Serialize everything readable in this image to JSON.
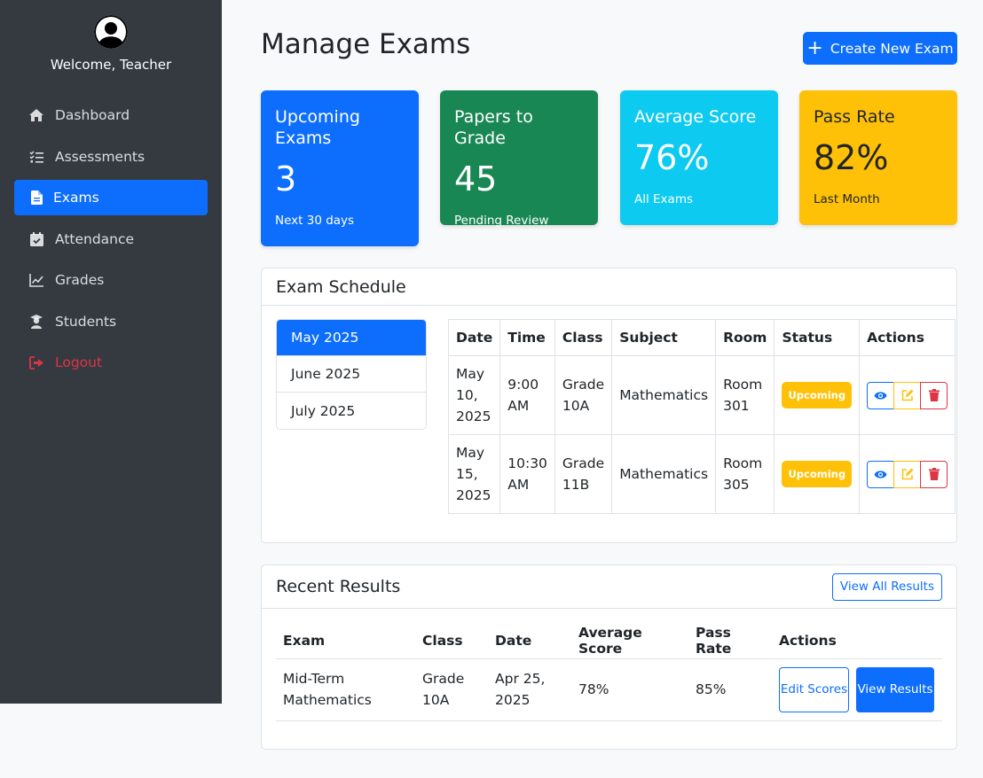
{
  "sidebar": {
    "welcome": "Welcome, Teacher",
    "items": [
      {
        "label": "Dashboard",
        "icon": "home-icon"
      },
      {
        "label": "Assessments",
        "icon": "tasks-icon"
      },
      {
        "label": "Exams",
        "icon": "file-icon",
        "active": true
      },
      {
        "label": "Attendance",
        "icon": "calendar-check-icon"
      },
      {
        "label": "Grades",
        "icon": "chart-line-icon"
      },
      {
        "label": "Students",
        "icon": "user-graduate-icon"
      },
      {
        "label": "Logout",
        "icon": "sign-out-icon"
      }
    ]
  },
  "header": {
    "title": "Manage Exams",
    "create_button": "Create New Exam"
  },
  "stats": [
    {
      "title": "Upcoming Exams",
      "value": "3",
      "sub": "Next 30 days",
      "color": "#0d6efd"
    },
    {
      "title": "Papers to Grade",
      "value": "45",
      "sub": "Pending Review",
      "color": "#198754"
    },
    {
      "title": "Average Score",
      "value": "76%",
      "sub": "All Exams",
      "color": "#0dcaf0"
    },
    {
      "title": "Pass Rate",
      "value": "82%",
      "sub": "Last Month",
      "color": "#ffc107"
    }
  ],
  "schedule": {
    "title": "Exam Schedule",
    "months": [
      "May 2025",
      "June 2025",
      "July 2025"
    ],
    "active_month": "May 2025",
    "columns": [
      "Date",
      "Time",
      "Class",
      "Subject",
      "Room",
      "Status",
      "Actions"
    ],
    "rows": [
      {
        "date": "May 10, 2025",
        "time": "9:00 AM",
        "class": "Grade 10A",
        "subject": "Mathematics",
        "room": "Room 301",
        "status": "Upcoming"
      },
      {
        "date": "May 15, 2025",
        "time": "10:30 AM",
        "class": "Grade 11B",
        "subject": "Mathematics",
        "room": "Room 305",
        "status": "Upcoming"
      }
    ]
  },
  "results": {
    "title": "Recent Results",
    "view_all": "View All Results",
    "columns": [
      "Exam",
      "Class",
      "Date",
      "Average Score",
      "Pass Rate",
      "Actions"
    ],
    "rows": [
      {
        "exam": "Mid-Term Mathematics",
        "class": "Grade 10A",
        "date": "Apr 25, 2025",
        "avg": "78%",
        "pass": "85%",
        "edit": "Edit Scores",
        "view": "View Results"
      }
    ]
  },
  "colors": {
    "primary": "#0d6efd",
    "success": "#198754",
    "info": "#0dcaf0",
    "warning": "#ffc107",
    "danger": "#dc3545",
    "sidebar_bg": "#343a40"
  }
}
